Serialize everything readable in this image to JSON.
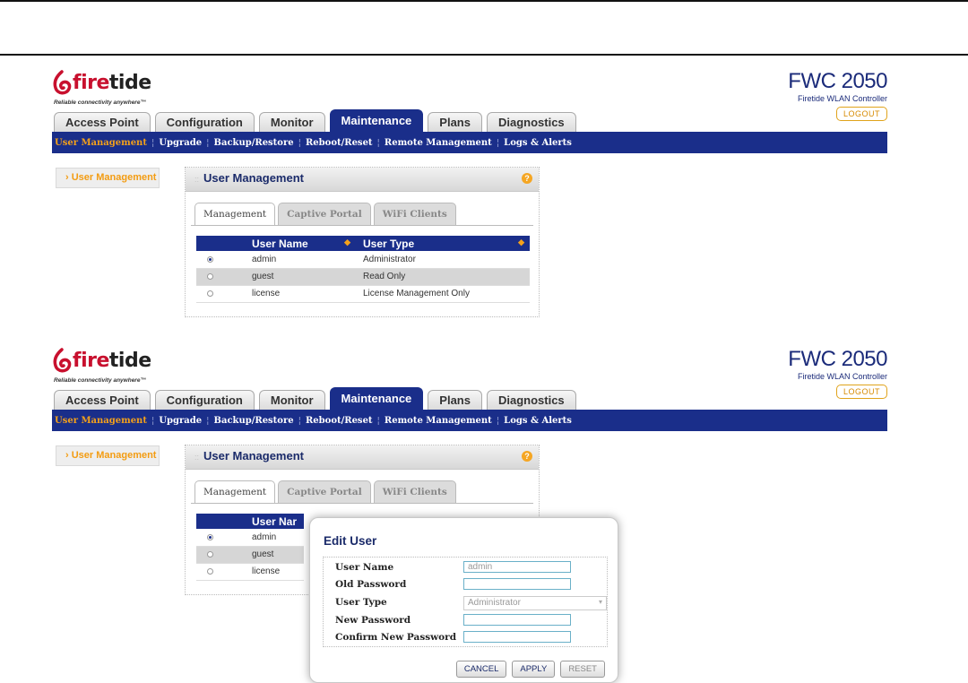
{
  "brand": {
    "logo_text_fire": "fire",
    "logo_text_tide": "tide",
    "tagline": "Reliable connectivity anywhere™"
  },
  "product": {
    "name": "FWC 2050",
    "subtitle": "Firetide WLAN Controller",
    "logout_label": "LOGOUT"
  },
  "tabs": [
    "Access Point",
    "Configuration",
    "Monitor",
    "Maintenance",
    "Plans",
    "Diagnostics"
  ],
  "active_tab": "Maintenance",
  "subnav": [
    "User Management",
    "Upgrade",
    "Backup/Restore",
    "Reboot/Reset",
    "Remote Management",
    "Logs & Alerts"
  ],
  "sidebar": {
    "item": "› User Management"
  },
  "panel": {
    "title": "User Management",
    "subtabs": [
      "Management",
      "Captive Portal",
      "WiFi Clients"
    ],
    "table": {
      "headers": [
        "User Name",
        "User Type"
      ],
      "rows": [
        {
          "name": "admin",
          "type": "Administrator",
          "selected": true
        },
        {
          "name": "guest",
          "type": "Read Only",
          "selected": false
        },
        {
          "name": "license",
          "type": "License Management Only",
          "selected": false
        }
      ]
    }
  },
  "second_header_partial": "User Nar",
  "modal": {
    "title": "Edit User",
    "fields": {
      "user_name_label": "User Name",
      "user_name_value": "admin",
      "old_password_label": "Old Password",
      "user_type_label": "User Type",
      "user_type_value": "Administrator",
      "new_password_label": "New Password",
      "confirm_password_label": "Confirm New Password"
    },
    "buttons": {
      "cancel": "CANCEL",
      "apply": "APPLY",
      "reset": "RESET"
    }
  },
  "colors": {
    "nav_blue": "#1a2e8a",
    "accent_orange": "#f4a11a",
    "logo_red": "#c8102e"
  }
}
